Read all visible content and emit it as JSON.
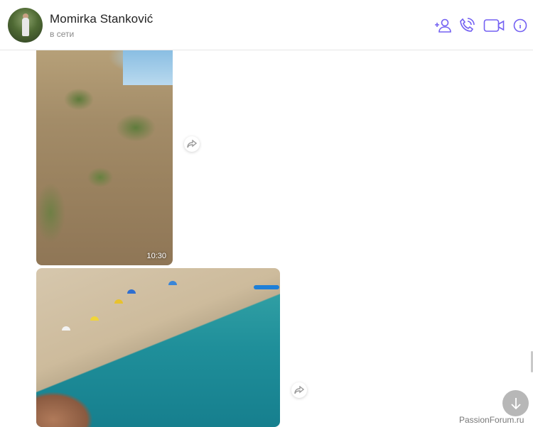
{
  "header": {
    "contact_name": "Momirka Stanković",
    "status": "в сети",
    "icons": [
      "add-contact-icon",
      "phone-icon",
      "video-icon",
      "info-icon"
    ],
    "accent_color": "#7360f2"
  },
  "messages": [
    {
      "type": "video",
      "time": "10:30",
      "description_icon": "share-icon"
    },
    {
      "type": "video",
      "description_icon": "share-icon"
    }
  ],
  "watermark": "PassionForum.ru"
}
